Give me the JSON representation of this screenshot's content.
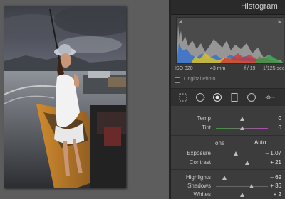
{
  "panel": {
    "title": "Histogram"
  },
  "histogram": {
    "iso": "ISO 320",
    "focal": "43 mm",
    "aperture": "f / 19",
    "shutter": "1/125 sec",
    "original_photo": "Original Photo"
  },
  "tools": [
    "crop-icon",
    "spot-removal-icon",
    "red-eye-icon",
    "graduated-filter-icon",
    "radial-filter-icon",
    "adjustment-brush-icon"
  ],
  "basic": {
    "temp": {
      "label": "Temp",
      "value": "0",
      "level": 0.5
    },
    "tint": {
      "label": "Tint",
      "value": "0",
      "level": 0.5
    },
    "tone_label": "Tone",
    "auto_label": "Auto",
    "exposure": {
      "label": "Exposure",
      "value": "– 1.07",
      "level": 0.39
    },
    "contrast": {
      "label": "Contrast",
      "value": "+ 21",
      "level": 0.6
    },
    "highlights": {
      "label": "Highlights",
      "value": "– 69",
      "level": 0.16
    },
    "shadows": {
      "label": "Shadows",
      "value": "+ 36",
      "level": 0.68
    },
    "whites": {
      "label": "Whites",
      "value": "+ 2",
      "level": 0.51
    }
  },
  "colors": {
    "panel_bg": "#383838",
    "header_bg": "#2a2a2a",
    "canvas_bg": "#5d5d5d"
  }
}
